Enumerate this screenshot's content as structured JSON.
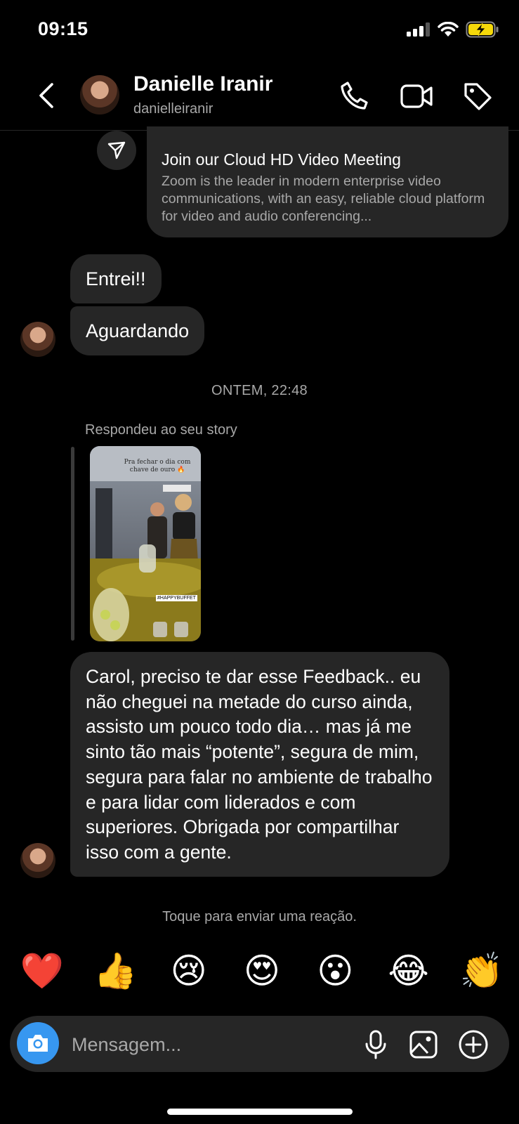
{
  "status_bar": {
    "time": "09:15"
  },
  "header": {
    "name": "Danielle Iranir",
    "username": "danielleiranir",
    "icons": [
      "back-icon",
      "phone-icon",
      "video-icon",
      "tag-icon"
    ]
  },
  "messages": {
    "link_card": {
      "title": "Join our Cloud HD Video Meeting",
      "description": "Zoom is the leader in modern enterprise video communications, with an easy, reliable cloud platform for video and audio conferencing..."
    },
    "msg1": "Entrei!!",
    "msg2": "Aguardando",
    "timestamp": "ONTEM, 22:48",
    "story_reply_label": "Respondeu ao seu story",
    "story_caption": "Pra fechar o dia com chave de ouro 🔥",
    "story_tag": "#HAPPYBUFFET",
    "long_message": "Carol, preciso te dar esse Feedback.. eu não cheguei na metade do curso ainda, assisto um pouco todo dia… mas já me sinto tão mais “potente”, segura de mim, segura para falar no ambiente de trabalho e para lidar com liderados e com superiores. Obrigada por compartilhar isso com a gente."
  },
  "reaction_hint": "Toque para enviar uma reação.",
  "reactions": [
    "❤️",
    "👍",
    "😢",
    "😍",
    "😮",
    "😂",
    "👏"
  ],
  "composer": {
    "placeholder": "Mensagem...",
    "icons": [
      "camera-icon",
      "microphone-icon",
      "gallery-icon",
      "plus-icon"
    ]
  },
  "colors": {
    "accent": "#3797f0",
    "bubble": "#262626",
    "background": "#000000",
    "secondary_text": "#a8a8a8",
    "battery": "#f5d90a"
  }
}
